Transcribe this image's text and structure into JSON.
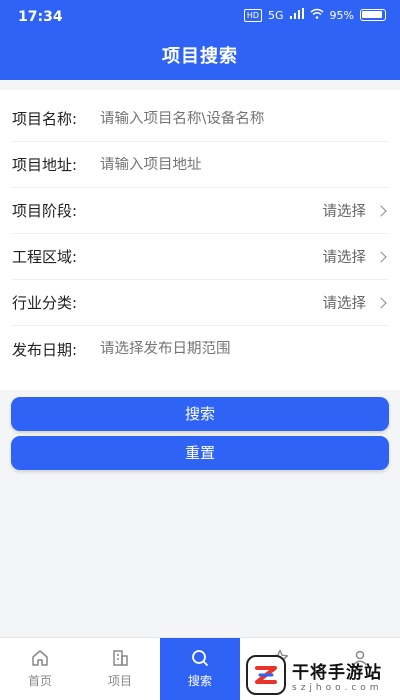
{
  "status_bar": {
    "time": "17:34",
    "hd_badge": "HD",
    "network": "5G",
    "battery_percent": "95%"
  },
  "header": {
    "title": "项目搜索"
  },
  "form": {
    "project_name": {
      "label": "项目名称:",
      "placeholder": "请输入项目名称\\设备名称"
    },
    "project_address": {
      "label": "项目地址:",
      "placeholder": "请输入项目地址"
    },
    "project_stage": {
      "label": "项目阶段:",
      "value": "请选择"
    },
    "project_region": {
      "label": "工程区域:",
      "value": "请选择"
    },
    "industry_category": {
      "label": "行业分类:",
      "value": "请选择"
    },
    "publish_date": {
      "label": "发布日期:",
      "placeholder": "请选择发布日期范围"
    }
  },
  "buttons": {
    "search": "搜索",
    "reset": "重置"
  },
  "tabbar": {
    "items": [
      {
        "label": "首页",
        "icon": "home-icon"
      },
      {
        "label": "项目",
        "icon": "building-icon"
      },
      {
        "label": "搜索",
        "icon": "search-icon",
        "active": true
      },
      {
        "label": "",
        "icon": "star-icon"
      },
      {
        "label": "",
        "icon": "user-icon"
      }
    ]
  },
  "watermark": {
    "title": "干将手游站",
    "subtitle": "szjhoo.com"
  },
  "colors": {
    "primary": "#2f63f5",
    "background": "#f4f5f7",
    "text": "#222222",
    "placeholder": "#8a8f97"
  }
}
